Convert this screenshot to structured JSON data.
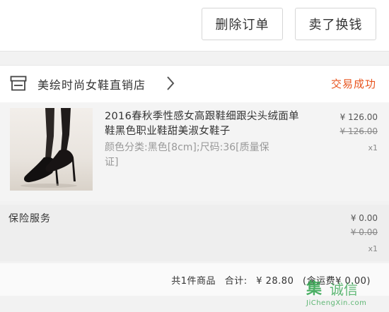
{
  "actions": {
    "delete_label": "删除订单",
    "sell_label": "卖了换钱"
  },
  "store": {
    "name": "美绘时尚女鞋直销店",
    "status": "交易成功",
    "icon": "store-icon"
  },
  "product": {
    "title": "2016春秋季性感女高跟鞋细跟尖头绒面单鞋黑色职业鞋甜美淑女鞋子",
    "spec": "颜色分类:黑色[8cm];尺码:36[质量保证]",
    "price": "¥ 126.00",
    "original_price": "¥ 126.00",
    "quantity": "x1"
  },
  "insurance": {
    "label": "保险服务",
    "price": "¥ 0.00",
    "original_price": "¥ 0.00",
    "quantity": "x1"
  },
  "summary": {
    "count_text": "共1件商品",
    "total_label": "合计:",
    "total": "¥ 28.80",
    "shipping": "(含运费¥ 0.00)"
  },
  "watermark": {
    "logo": "集",
    "name": "诚信",
    "url": "JiChengXin.com"
  },
  "colors": {
    "status": "#e8541e",
    "watermark": "#2da24a"
  }
}
